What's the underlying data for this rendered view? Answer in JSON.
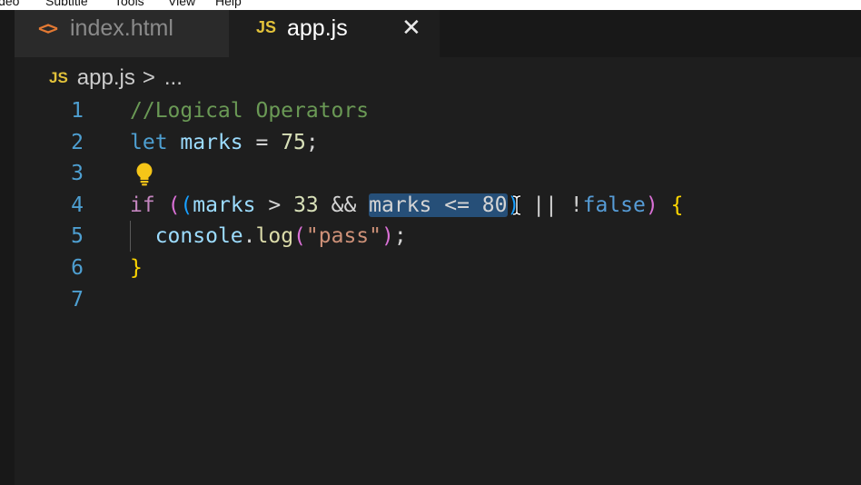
{
  "menubar": {
    "items": [
      "ideo",
      "Subtitle",
      "Tools",
      "View",
      "Help"
    ]
  },
  "tabs": [
    {
      "label": "index.html",
      "icon": "html-brackets-icon",
      "active": false
    },
    {
      "label": "app.js",
      "icon": "js-icon",
      "active": true
    }
  ],
  "tab_icons": {
    "html": "<>",
    "js": "JS",
    "close": "✕"
  },
  "breadcrumb": {
    "icon": "JS",
    "file": "app.js",
    "separator": ">",
    "rest": "..."
  },
  "editor": {
    "line_numbers": [
      "1",
      "2",
      "3",
      "4",
      "5",
      "6",
      "7"
    ],
    "lines": [
      {
        "tokens": [
          {
            "t": "//Logical Operators",
            "c": "comment"
          }
        ]
      },
      {
        "tokens": [
          {
            "t": "let",
            "c": "keyword"
          },
          {
            "t": " ",
            "c": "op"
          },
          {
            "t": "marks",
            "c": "var"
          },
          {
            "t": " = ",
            "c": "op"
          },
          {
            "t": "75",
            "c": "num"
          },
          {
            "t": ";",
            "c": "op"
          }
        ]
      },
      {
        "tokens": []
      },
      {
        "tokens": [
          {
            "t": "if",
            "c": "ctrl"
          },
          {
            "t": " ",
            "c": "op"
          },
          {
            "t": "(",
            "c": "paren1"
          },
          {
            "t": "(",
            "c": "paren2"
          },
          {
            "t": "marks",
            "c": "var"
          },
          {
            "t": " > ",
            "c": "op"
          },
          {
            "t": "33",
            "c": "num"
          },
          {
            "t": " && ",
            "c": "op"
          },
          {
            "t": "marks <= 80",
            "c": "sel"
          },
          {
            "t": ")",
            "c": "paren2"
          },
          {
            "t": " || ",
            "c": "op"
          },
          {
            "t": "!",
            "c": "op"
          },
          {
            "t": "false",
            "c": "bool"
          },
          {
            "t": ")",
            "c": "paren1"
          },
          {
            "t": " ",
            "c": "op"
          },
          {
            "t": "{",
            "c": "brace"
          }
        ]
      },
      {
        "tokens": [
          {
            "t": "  ",
            "c": "op"
          },
          {
            "t": "console",
            "c": "prop"
          },
          {
            "t": ".",
            "c": "op"
          },
          {
            "t": "log",
            "c": "func"
          },
          {
            "t": "(",
            "c": "paren1"
          },
          {
            "t": "\"pass\"",
            "c": "string"
          },
          {
            "t": ")",
            "c": "paren1"
          },
          {
            "t": ";",
            "c": "op"
          }
        ]
      },
      {
        "tokens": [
          {
            "t": "}",
            "c": "brace"
          }
        ]
      },
      {
        "tokens": []
      }
    ],
    "selected_text": "marks <= 80",
    "lightbulb_line": 3
  },
  "colors": {
    "background": "#1e1e1e",
    "tabbar": "#181818",
    "inactive_tab": "#2a2a2a",
    "line_number": "#4e9fd1",
    "js_icon": "#e2c23a",
    "html_icon": "#e37933",
    "selection": "#264f78",
    "lightbulb": "#f5c518"
  }
}
